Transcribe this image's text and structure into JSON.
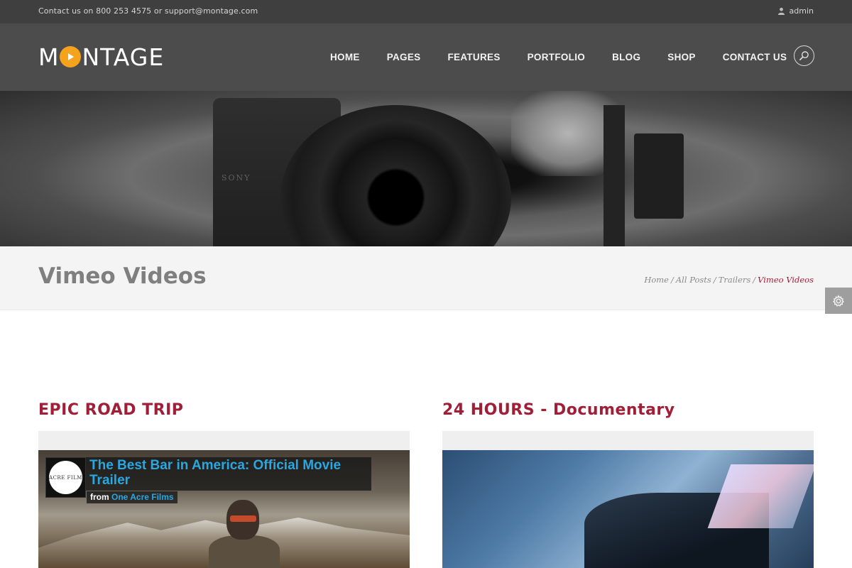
{
  "topbar": {
    "contact": "Contact us on 800 253 4575 or support@montage.com",
    "user": "admin",
    "user_icon": "user-icon"
  },
  "header": {
    "logo_text_before": "M",
    "logo_text_after": "NTAGE",
    "logo_accent_color": "#f5a21c",
    "nav": [
      "HOME",
      "PAGES",
      "FEATURES",
      "PORTFOLIO",
      "BLOG",
      "SHOP",
      "CONTACT US"
    ],
    "search_icon": "search-icon"
  },
  "hero": {
    "camera_brand": "SONY"
  },
  "title_bar": {
    "title": "Vimeo Videos",
    "breadcrumbs": [
      "Home",
      "All Posts",
      "Trailers"
    ],
    "breadcrumb_separator": "/",
    "current": "Vimeo Videos",
    "accent_color": "#a01e36"
  },
  "settings_icon": "gear-icon",
  "posts": [
    {
      "title": "EPIC ROAD TRIP",
      "video": {
        "title": "The Best Bar in America: Official Movie Trailer",
        "from_label": "from",
        "author": "One Acre Films",
        "thumb_text": "ACRE FILM"
      }
    },
    {
      "title": "24 HOURS - Documentary"
    }
  ]
}
